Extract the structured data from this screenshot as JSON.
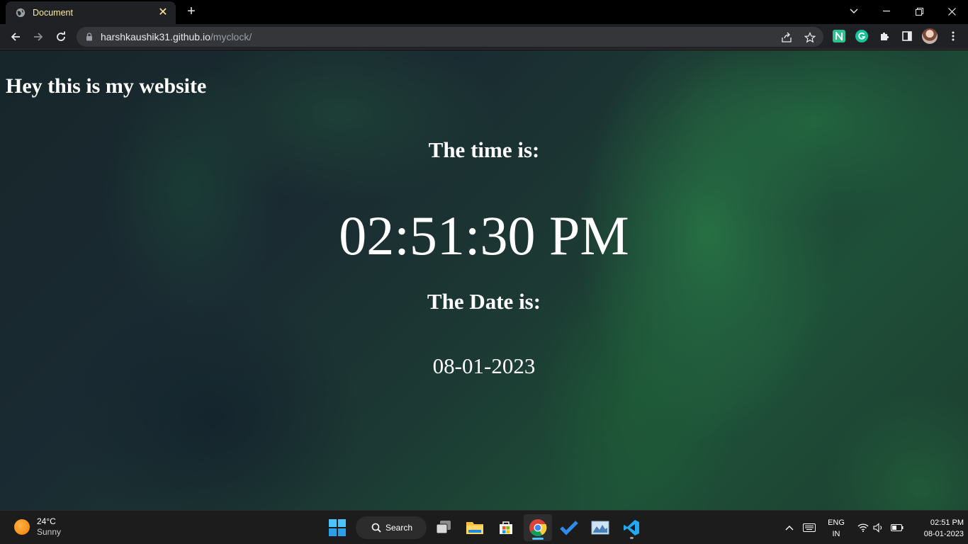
{
  "browser": {
    "tab_title": "Document",
    "url_host": "harshkaushik31.github.io",
    "url_path": "/myclock/"
  },
  "page": {
    "heading": "Hey this is my website",
    "time_label": "The time is:",
    "time_value": "02:51:30 PM",
    "date_label": "The Date is:",
    "date_value": "08-01-2023"
  },
  "taskbar": {
    "weather_temp": "24°C",
    "weather_condition": "Sunny",
    "search_label": "Search",
    "language_primary": "ENG",
    "language_secondary": "IN",
    "clock_time": "02:51 PM",
    "clock_date": "08-01-2023"
  },
  "colors": {
    "tab_text": "#fbe9a0",
    "chrome_bg": "#202124",
    "taskbar_bg": "#1c1c1c",
    "accent": "#4cc2ff"
  }
}
